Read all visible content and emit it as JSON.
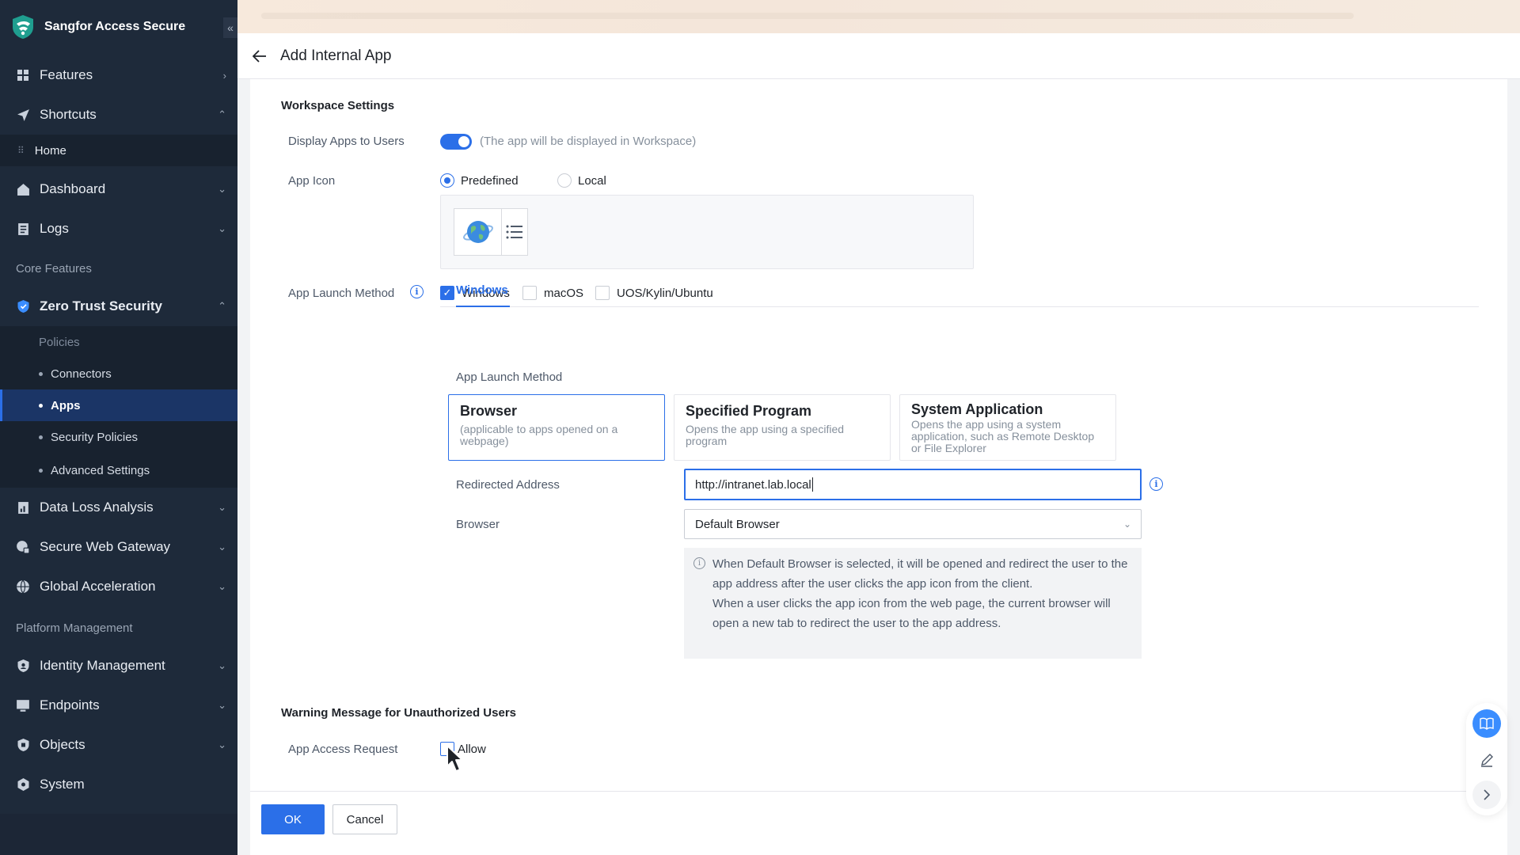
{
  "app": {
    "name": "Sangfor Access Secure"
  },
  "sidebar": {
    "features": "Features",
    "shortcuts": "Shortcuts",
    "home": "Home",
    "dashboard": "Dashboard",
    "logs": "Logs",
    "core_section": "Core Features",
    "zero_trust": "Zero Trust Security",
    "zero_trust_items": {
      "policies": "Policies",
      "connectors": "Connectors",
      "apps": "Apps",
      "security_policies": "Security Policies",
      "advanced_settings": "Advanced Settings"
    },
    "data_loss": "Data Loss Analysis",
    "swg": "Secure Web Gateway",
    "global_accel": "Global Acceleration",
    "platform_section": "Platform Management",
    "identity": "Identity Management",
    "endpoints": "Endpoints",
    "objects": "Objects",
    "system": "System"
  },
  "header": {
    "title": "Add Internal App"
  },
  "workspace": {
    "section_title": "Workspace Settings",
    "display_label": "Display Apps to Users",
    "display_enabled": true,
    "display_hint": "(The app will be displayed in Workspace)",
    "icon_label": "App Icon",
    "icon_options": {
      "predefined": "Predefined",
      "local": "Local"
    },
    "icon_selected": "Predefined",
    "launch_label": "App Launch Method",
    "os": {
      "windows": "Windows",
      "macos": "macOS",
      "uos": "UOS/Kylin/Ubuntu"
    },
    "os_checked": [
      "Windows"
    ],
    "tab": "Windows",
    "method_label": "App Launch Method",
    "methods": {
      "browser_title": "Browser",
      "browser_desc": "(applicable to apps opened on a webpage)",
      "program_title": "Specified Program",
      "program_desc": "Opens the app using a specified program",
      "system_title": "System Application",
      "system_desc": "Opens the app using a system application, such as Remote Desktop or File Explorer"
    },
    "method_selected": "Browser",
    "redirect_label": "Redirected Address",
    "redirect_value": "http://intranet.lab.local",
    "browser_label": "Browser",
    "browser_value": "Default Browser",
    "note_line1": "When Default Browser is selected, it will be opened and redirect the user to the app address after the user clicks the app icon from the client.",
    "note_line2": "When a user clicks the app icon from the web page, the current browser will open a new tab to redirect the user to the app address."
  },
  "warning": {
    "section_title": "Warning Message for Unauthorized Users",
    "request_label": "App Access Request",
    "allow_label": "Allow",
    "allow_checked": false
  },
  "footer": {
    "ok": "OK",
    "cancel": "Cancel"
  },
  "colors": {
    "accent": "#2b6fe8",
    "sidebar_bg": "#1e2a3a",
    "active_item": "#1b3566"
  }
}
